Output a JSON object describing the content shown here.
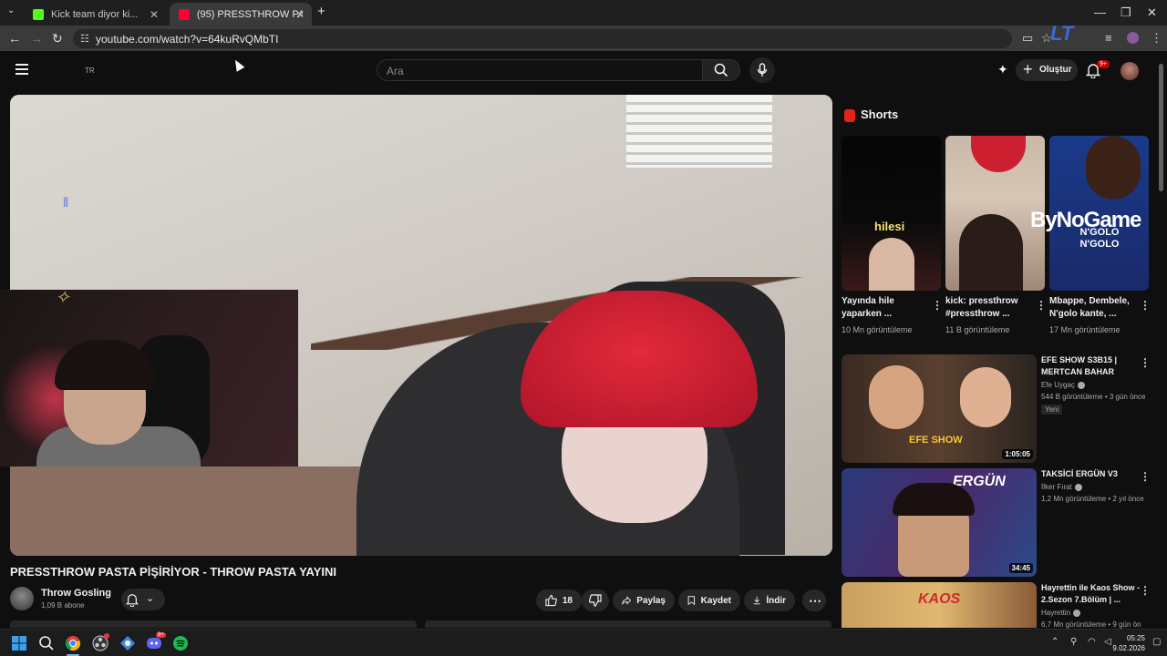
{
  "browser": {
    "tabs": [
      {
        "title": "Kick team diyor ki..."
      },
      {
        "title": "(95) PRESSTHROW PASTA PİŞİRİ"
      }
    ],
    "url": "youtube.com/watch?v=64kuRvQMbTI"
  },
  "header": {
    "region": "TR",
    "search_placeholder": "Ara",
    "create_label": "Oluştur",
    "notification_count": "9+"
  },
  "video": {
    "title": "PRESSTHROW PASTA PİŞİRİYOR - THROW PASTA YAYINI",
    "channel": "Throw Gosling",
    "subscribers": "1,09 B abone",
    "likes": "18",
    "share_label": "Paylaş",
    "save_label": "Kaydet",
    "download_label": "İndir"
  },
  "shorts": {
    "heading": "Shorts",
    "items": [
      {
        "title": "Yayında hile yaparken ...",
        "views": "10 Mn görüntüleme",
        "overlay": "hilesi"
      },
      {
        "title": "kick: pressthrow #pressthrow ...",
        "views": "11 B görüntüleme",
        "overlay": ""
      },
      {
        "title": "Mbappe, Dembele, N'golo kante, ...",
        "views": "17 Mn görüntüleme",
        "overlay": "N'GOLO N'GOLO"
      }
    ]
  },
  "watermark": "ByNoGame",
  "recommendations": [
    {
      "title": "EFE SHOW S3B15 | MERTCAN BAHAR",
      "channel": "Efe Uygaç",
      "meta": "544 B görüntüleme • 3 gün önce",
      "badge": "Yeni",
      "duration": "1:05:05",
      "overlay": "EFE SHOW"
    },
    {
      "title": "TAKSİCİ ERGÜN V3",
      "channel": "İlker Fırat",
      "meta": "1,2 Mn görüntüleme • 2 yıl önce",
      "badge": "",
      "duration": "34:45",
      "overlay": "ERGÜN"
    },
    {
      "title": "Hayrettin ile Kaos Show - 2.Sezon 7.Bölüm | ...",
      "channel": "Hayrettin",
      "meta": "6,7 Mn görüntüleme • 9 gün ön",
      "badge": "",
      "duration": "",
      "overlay": "KAOS"
    }
  ],
  "taskbar": {
    "time": "05:25",
    "date": "9.02.2026",
    "discord_badge": "9+"
  },
  "colors": {
    "accent_red": "#cc0000",
    "background": "#0f0f0f",
    "pill": "#272727"
  }
}
